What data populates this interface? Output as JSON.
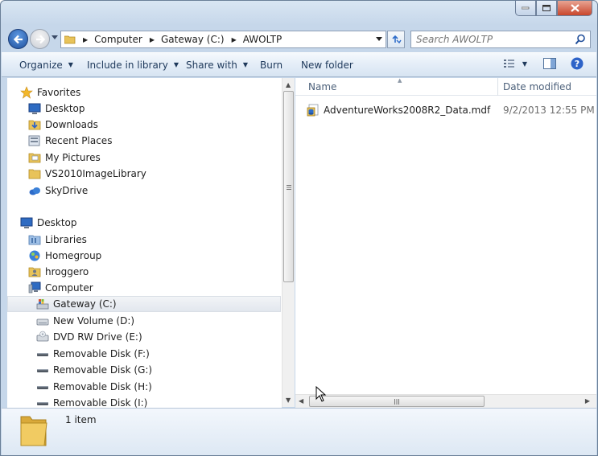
{
  "window": {
    "caption_buttons": [
      "minimize",
      "maximize",
      "close"
    ]
  },
  "address_bar": {
    "breadcrumbs": [
      "Computer",
      "Gateway (C:)",
      "AWOLTP"
    ]
  },
  "search": {
    "placeholder": "Search AWOLTP"
  },
  "toolbar": {
    "organize": "Organize",
    "include_in_library": "Include in library",
    "share_with": "Share with",
    "burn": "Burn",
    "new_folder": "New folder"
  },
  "nav_pane": {
    "favorites_header": "Favorites",
    "favorites": [
      {
        "label": "Desktop",
        "icon": "desktop-icon"
      },
      {
        "label": "Downloads",
        "icon": "downloads-icon"
      },
      {
        "label": "Recent Places",
        "icon": "recent-places-icon"
      },
      {
        "label": "My Pictures",
        "icon": "pictures-folder-icon"
      },
      {
        "label": "VS2010ImageLibrary",
        "icon": "folder-icon"
      },
      {
        "label": "SkyDrive",
        "icon": "skydrive-icon"
      }
    ],
    "desktop_header": "Desktop",
    "tree": [
      {
        "label": "Libraries",
        "icon": "libraries-icon"
      },
      {
        "label": "Homegroup",
        "icon": "homegroup-icon"
      },
      {
        "label": "hroggero",
        "icon": "user-folder-icon"
      },
      {
        "label": "Computer",
        "icon": "computer-icon"
      },
      {
        "label": "Gateway (C:)",
        "icon": "system-drive-icon",
        "selected": true
      },
      {
        "label": "New Volume (D:)",
        "icon": "hard-drive-icon"
      },
      {
        "label": "DVD RW Drive (E:)",
        "icon": "dvd-drive-icon"
      },
      {
        "label": "Removable Disk (F:)",
        "icon": "removable-disk-icon"
      },
      {
        "label": "Removable Disk (G:)",
        "icon": "removable-disk-icon"
      },
      {
        "label": "Removable Disk (H:)",
        "icon": "removable-disk-icon"
      },
      {
        "label": "Removable Disk (I:)",
        "icon": "removable-disk-icon"
      }
    ]
  },
  "content": {
    "columns": {
      "name": "Name",
      "date_modified": "Date modified"
    },
    "files": [
      {
        "name": "AdventureWorks2008R2_Data.mdf",
        "date_modified": "9/2/2013 12:55 PM",
        "icon": "database-file-icon"
      }
    ]
  },
  "details_pane": {
    "item_count": "1 item"
  },
  "colors": {
    "accent": "#1e395b",
    "selection": "#e2e7ee",
    "folder": "#e8c35a"
  }
}
